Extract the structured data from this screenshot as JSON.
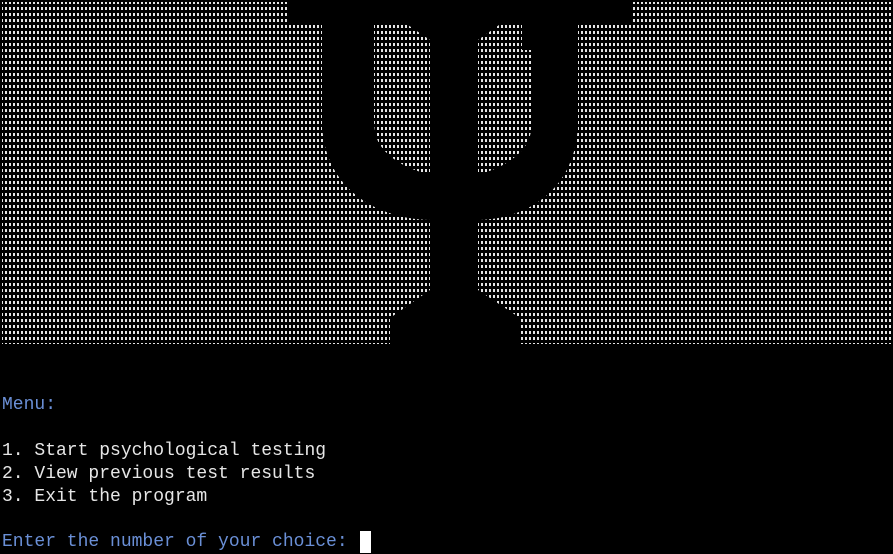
{
  "colors": {
    "background": "#000000",
    "ascii_dots": "#e6e6e6",
    "accent_blue": "#6a8fd6",
    "menu_text": "#e6e6e6",
    "cursor": "#ffffff"
  },
  "banner": {
    "icon": "psi-symbol-icon"
  },
  "menu": {
    "title": "Menu:",
    "options": [
      "1. Start psychological testing",
      "2. View previous test results",
      "3. Exit the program"
    ]
  },
  "prompt": {
    "label": "Enter the number of your choice: "
  }
}
